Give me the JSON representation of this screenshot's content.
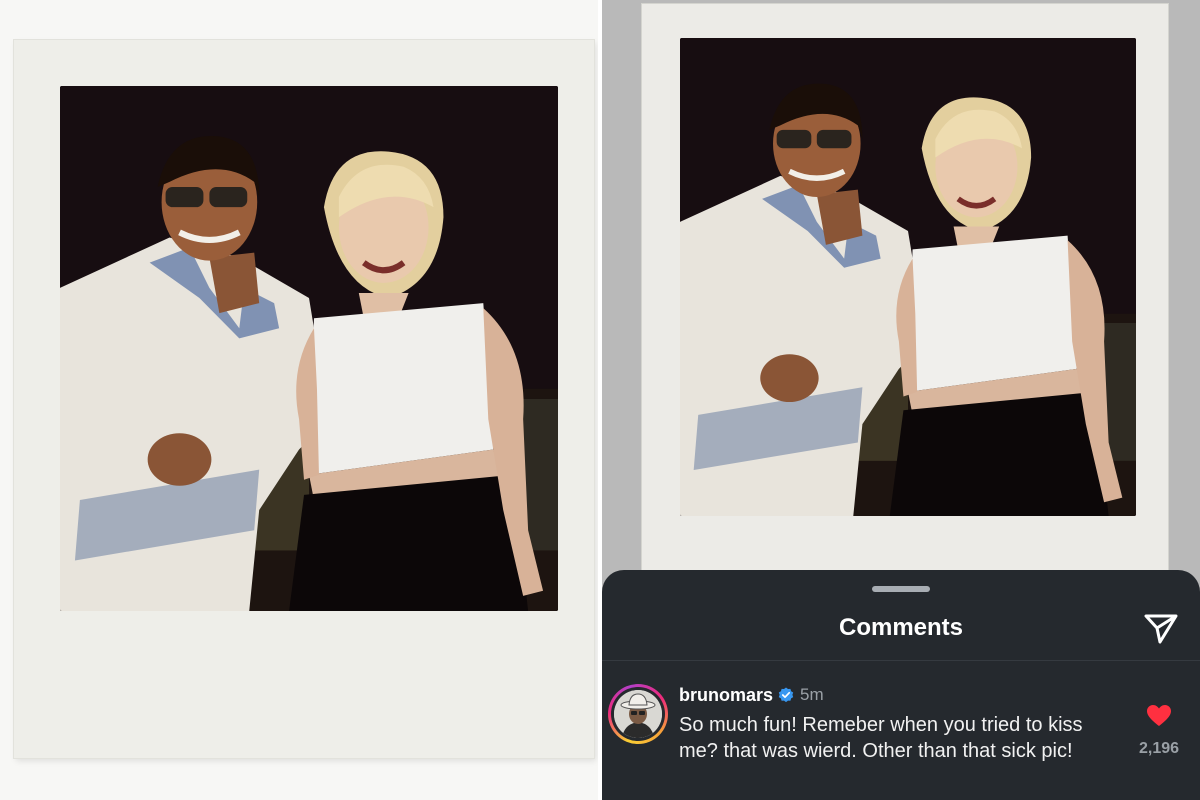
{
  "sheet": {
    "title": "Comments"
  },
  "comment": {
    "username": "brunomars",
    "timestamp": "5m",
    "text": "So much fun! Remeber when you tried to kiss me? that was wierd. Other than that sick pic!",
    "like_count": "2,196"
  },
  "icons": {
    "share": "paper-plane-icon",
    "verified": "verified-badge-icon",
    "like": "heart-icon"
  },
  "colors": {
    "sheet_background": "#25292e",
    "verified": "#3897f0",
    "like": "#ff3040"
  }
}
